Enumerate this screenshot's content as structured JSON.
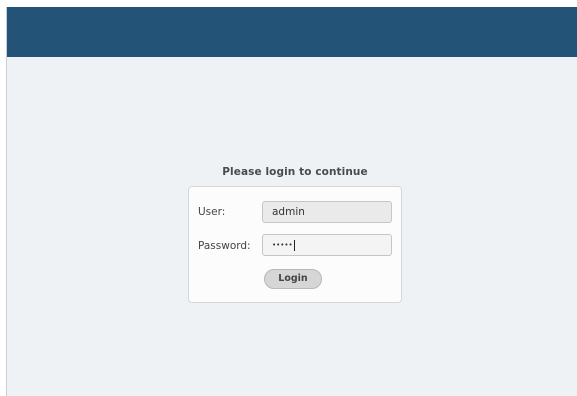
{
  "login": {
    "title": "Please login to continue",
    "user_label": "User:",
    "user_value": "admin",
    "password_label": "Password:",
    "password_value": "•••••",
    "login_button": "Login"
  },
  "colors": {
    "header": "#235478",
    "background": "#eff2f5"
  }
}
